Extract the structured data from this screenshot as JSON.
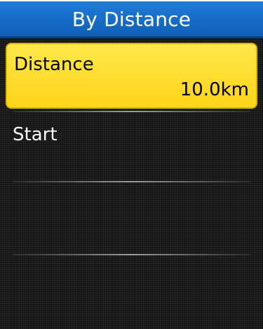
{
  "header": {
    "title": "By Distance"
  },
  "menu": {
    "items": [
      {
        "label": "Distance",
        "value": "10.0km",
        "selected": true
      },
      {
        "label": "Start",
        "selected": false
      }
    ]
  },
  "colors": {
    "title_bar": "#1668c4",
    "selected_item": "#ffdf2f",
    "background": "#141414",
    "text_light": "#ffffff",
    "text_dark": "#000000"
  }
}
